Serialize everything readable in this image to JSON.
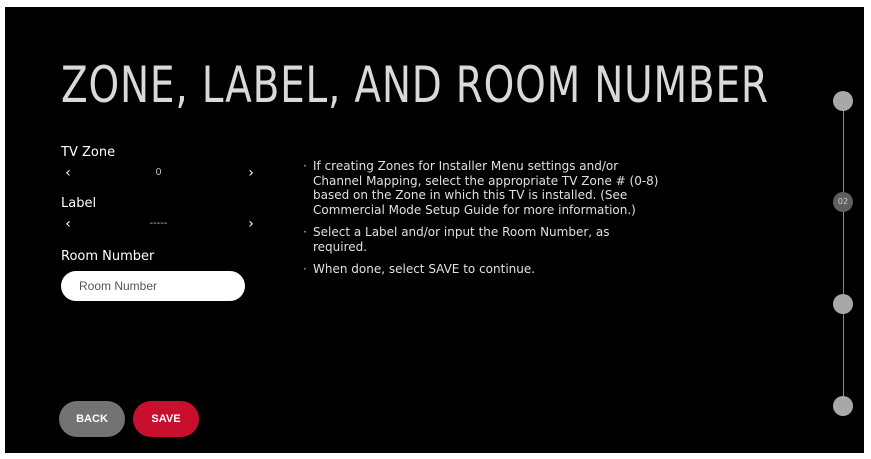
{
  "header": {
    "title": "ZONE, LABEL, AND ROOM NUMBER"
  },
  "form": {
    "tv_zone": {
      "label": "TV Zone",
      "value": "0",
      "prev_arrow": "‹",
      "next_arrow": "›"
    },
    "label": {
      "label": "Label",
      "value": "-----",
      "prev_arrow": "‹",
      "next_arrow": "›"
    },
    "room_number": {
      "label": "Room Number",
      "placeholder": "Room Number",
      "value": ""
    }
  },
  "info": {
    "bullet": "·",
    "items": [
      "If creating Zones for Installer Menu settings and/or Channel Mapping, select the appropriate TV Zone # (0-8) based on the Zone in which this TV is installed. (See Commercial Mode Setup Guide for more information.)",
      "Select a Label and/or input the Room Number, as required.",
      "When done, select SAVE to continue."
    ]
  },
  "buttons": {
    "back_label": "BACK",
    "save_label": "SAVE"
  },
  "progress": {
    "current_step_label": "02",
    "current_step": 2,
    "total_steps": 4
  },
  "colors": {
    "background": "#000000",
    "accent": "#c8102e",
    "back_button": "#737373",
    "step_dot": "#a8a8a8"
  }
}
